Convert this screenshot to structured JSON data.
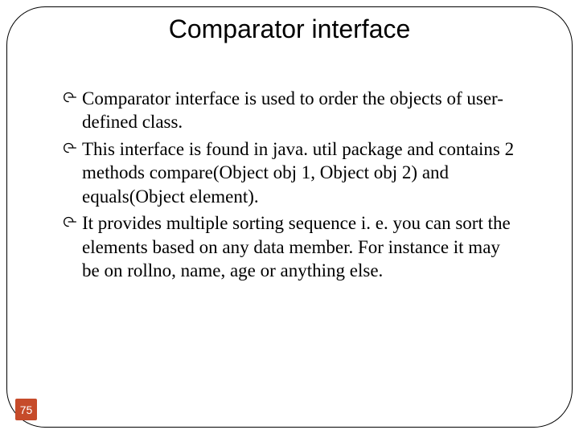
{
  "title": "Comparator interface",
  "bullets": [
    {
      "lead": "Comparator interface",
      "rest": " is used to order the objects of user-defined class."
    },
    {
      "lead": "",
      "rest": "This interface is found in java. util package and contains 2 methods compare(Object obj 1, Object obj 2) and equals(Object element)."
    },
    {
      "lead": "",
      "rest": "It provides multiple sorting sequence i. e. you can sort the elements based on any data member. For instance it may be on rollno, name, age or anything else."
    }
  ],
  "page_number": "75",
  "colors": {
    "accent": "#c64b2a"
  }
}
